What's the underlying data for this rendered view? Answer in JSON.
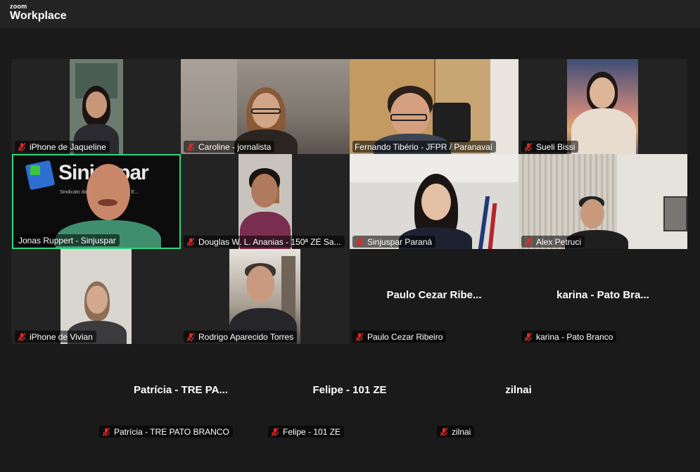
{
  "app": {
    "brand_top": "zoom",
    "brand_main": "Workplace"
  },
  "colors": {
    "active_speaker_border": "#2fd57f",
    "muted_icon": "#e02828",
    "background": "#1a1a1a"
  },
  "participants": [
    {
      "name": "iPhone de Jaqueline",
      "muted": true,
      "video": true
    },
    {
      "name": "Caroline - jornalista",
      "muted": true,
      "video": true
    },
    {
      "name": "Fernando Tibério - JFPR / Paranavaí",
      "muted": false,
      "video": true
    },
    {
      "name": "Sueli Bissi",
      "muted": true,
      "video": true
    },
    {
      "name": "Jonas Ruppert - Sinjuspar",
      "muted": false,
      "video": true,
      "active": true,
      "background_text": "Sinjuspar",
      "background_subtext": "Sindicato do... Justiça Federal e E..."
    },
    {
      "name": "Douglas W. L. Ananias - 150ª ZE Sa...",
      "muted": true,
      "video": true
    },
    {
      "name": "Sinjuspar Paraná",
      "muted": true,
      "video": true
    },
    {
      "name": "Alex Petruci",
      "muted": true,
      "video": true
    },
    {
      "name": "iPhone de Vivian",
      "muted": true,
      "video": true
    },
    {
      "name": "Rodrigo Aparecido Torres",
      "muted": true,
      "video": true
    },
    {
      "name": "Paulo Cezar Ribeiro",
      "display_name": "Paulo Cezar Ribe...",
      "muted": true,
      "video": false
    },
    {
      "name": "karina - Pato Branco",
      "display_name": "karina - Pato Bra...",
      "muted": true,
      "video": false
    },
    {
      "name": "Patrícia - TRE PATO BRANCO",
      "display_name": "Patrícia - TRE PA...",
      "muted": true,
      "video": false
    },
    {
      "name": "Felipe - 101 ZE",
      "display_name": "Felipe - 101 ZE",
      "muted": true,
      "video": false
    },
    {
      "name": "zilnai",
      "display_name": "zilnai",
      "muted": true,
      "video": false
    }
  ]
}
